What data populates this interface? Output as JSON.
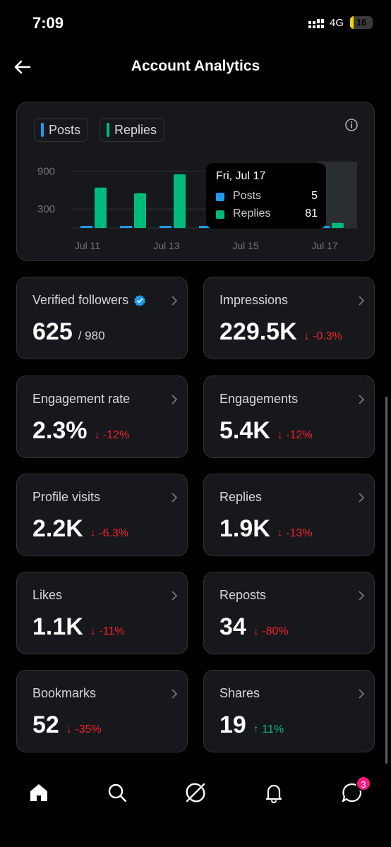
{
  "status_bar": {
    "time": "7:09",
    "network": "4G",
    "battery": "16",
    "battery_level": 0.16
  },
  "header": {
    "title": "Account Analytics"
  },
  "chart_card": {
    "legend": [
      {
        "label": "Posts",
        "color": "#1d9bf0"
      },
      {
        "label": "Replies",
        "color": "#00ba7c"
      }
    ],
    "tooltip": {
      "date": "Fri, Jul 17",
      "rows": [
        {
          "label": "Posts",
          "value": "5",
          "color": "#1d9bf0"
        },
        {
          "label": "Replies",
          "value": "81",
          "color": "#00ba7c"
        }
      ]
    }
  },
  "chart_data": {
    "type": "bar",
    "categories": [
      "Jul 11",
      "Jul 12",
      "Jul 13",
      "Jul 14",
      "Jul 15",
      "Jul 16",
      "Jul 17"
    ],
    "x_tick_labels": [
      "Jul 11",
      "Jul 13",
      "Jul 15",
      "Jul 17"
    ],
    "y_tick_labels": [
      "900",
      "300"
    ],
    "y_ticks": [
      900,
      300
    ],
    "ylim": [
      0,
      1050
    ],
    "series": [
      {
        "name": "Posts",
        "color": "#1d9bf0",
        "values": [
          25,
          25,
          25,
          10,
          10,
          25,
          5
        ]
      },
      {
        "name": "Replies",
        "color": "#00ba7c",
        "values": [
          640,
          550,
          850,
          20,
          20,
          30,
          81
        ]
      }
    ],
    "highlighted_category": "Jul 17",
    "grid": true
  },
  "metrics": [
    {
      "label": "Verified followers",
      "value": "625",
      "sub": "/ 980",
      "verified": true
    },
    {
      "label": "Impressions",
      "value": "229.5K",
      "delta": "↓ -0.3%",
      "direction": "down"
    },
    {
      "label": "Engagement rate",
      "value": "2.3%",
      "delta": "↓ -12%",
      "direction": "down"
    },
    {
      "label": "Engagements",
      "value": "5.4K",
      "delta": "↓ -12%",
      "direction": "down"
    },
    {
      "label": "Profile visits",
      "value": "2.2K",
      "delta": "↓ -6.3%",
      "direction": "down"
    },
    {
      "label": "Replies",
      "value": "1.9K",
      "delta": "↓ -13%",
      "direction": "down"
    },
    {
      "label": "Likes",
      "value": "1.1K",
      "delta": "↓ -11%",
      "direction": "down"
    },
    {
      "label": "Reposts",
      "value": "34",
      "delta": "↓ -80%",
      "direction": "down"
    },
    {
      "label": "Bookmarks",
      "value": "52",
      "delta": "↓ -35%",
      "direction": "down"
    },
    {
      "label": "Shares",
      "value": "19",
      "delta": "↑ 11%",
      "direction": "up"
    }
  ],
  "bottom_nav": {
    "items": [
      "home-icon",
      "search-icon",
      "grok-icon",
      "bell-icon",
      "messages-icon"
    ],
    "messages_badge": "3"
  }
}
